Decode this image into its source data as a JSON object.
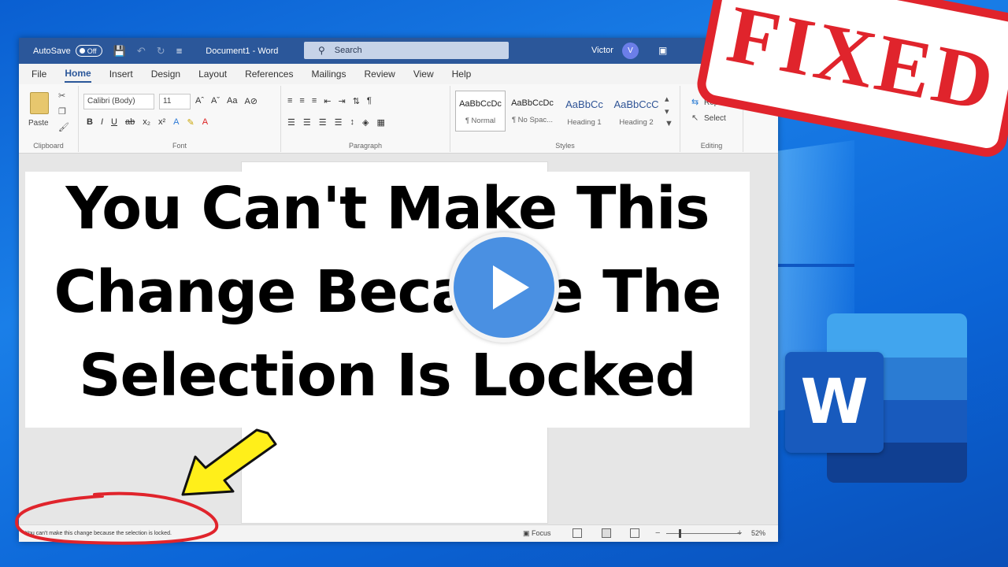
{
  "window": {
    "autosave_label": "AutoSave",
    "autosave_state": "Off",
    "doc_title": "Document1 - Word",
    "search_placeholder": "Search",
    "user_name": "Victor",
    "user_initial": "V"
  },
  "menu": {
    "tabs": [
      "File",
      "Home",
      "Insert",
      "Design",
      "Layout",
      "References",
      "Mailings",
      "Review",
      "View",
      "Help"
    ],
    "active": "Home"
  },
  "ribbon": {
    "clipboard": {
      "label": "Clipboard",
      "paste": "Paste"
    },
    "font": {
      "label": "Font",
      "family": "Calibri (Body)",
      "size": "11"
    },
    "paragraph": {
      "label": "Paragraph"
    },
    "styles": {
      "label": "Styles",
      "items": [
        {
          "sample": "AaBbCcDc",
          "name": "¶ Normal"
        },
        {
          "sample": "AaBbCcDc",
          "name": "¶ No Spac..."
        },
        {
          "sample": "AaBbCc",
          "name": "Heading 1"
        },
        {
          "sample": "AaBbCcC",
          "name": "Heading 2"
        }
      ]
    },
    "editing": {
      "label": "Editing",
      "replace": "Replace",
      "select": "Select"
    }
  },
  "statusbar": {
    "message": "You can't make this change because the selection is locked.",
    "focus": "Focus",
    "zoom": "52%"
  },
  "headline": {
    "line1": "You Can't Make This",
    "line2": "Change Because The",
    "line3": "Selection Is Locked"
  },
  "stamp": {
    "text": "FIXED"
  },
  "logo": {
    "letter": "W"
  },
  "colors": {
    "word_blue": "#2b579a",
    "stamp_red": "#e0242c",
    "arrow_yellow": "#ffef1a",
    "play_blue": "#4a90e2"
  }
}
